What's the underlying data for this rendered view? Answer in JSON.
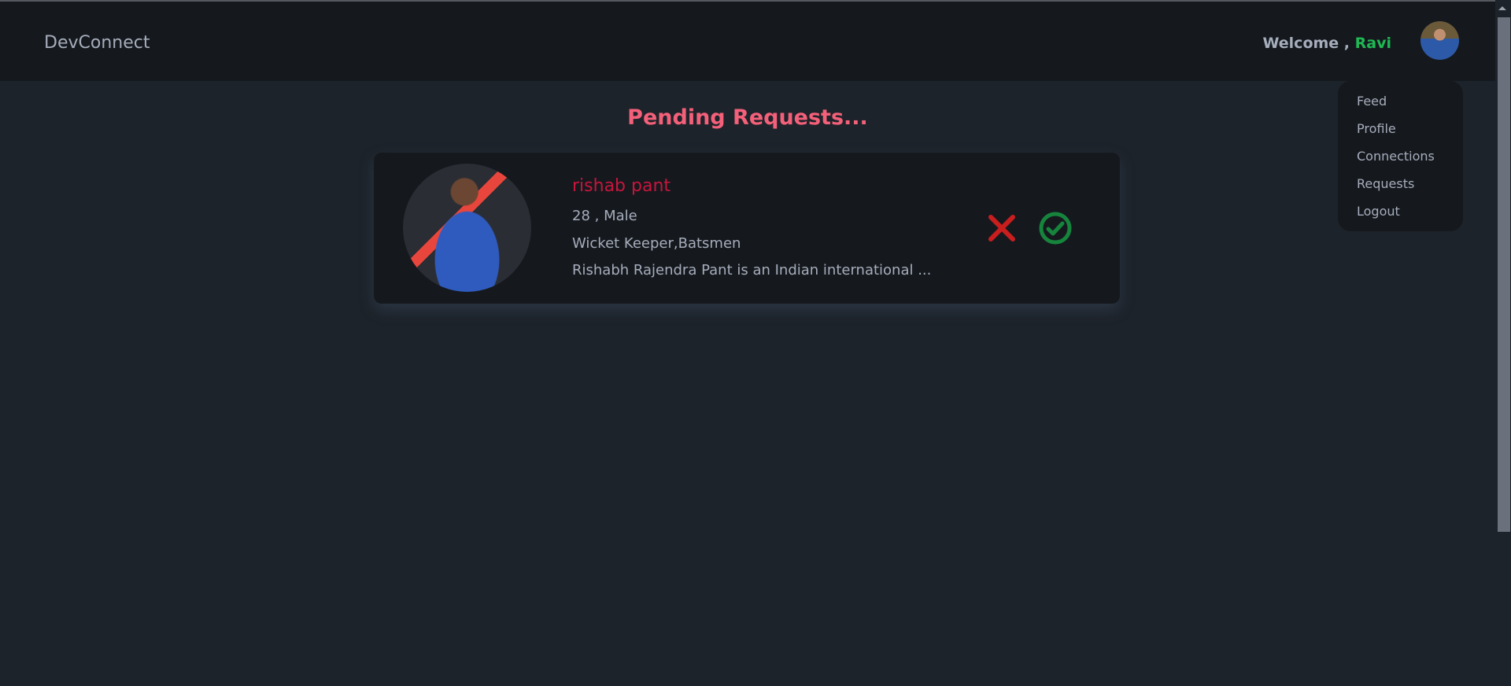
{
  "navbar": {
    "brand": "DevConnect",
    "welcome": "Welcome , ",
    "user_name": "Ravi"
  },
  "menu": [
    "Feed",
    "Profile",
    "Connections",
    "Requests",
    "Logout"
  ],
  "page_title": "Pending Requests...",
  "requests": [
    {
      "name": "rishab pant",
      "age_gender": "28 , Male",
      "skills": "Wicket Keeper,Batsmen",
      "about": "Rishabh Rajendra Pant is an Indian international ..."
    }
  ],
  "colors": {
    "accent": "#f4607a",
    "name": "#c8153c",
    "success": "#16843c",
    "reject": "#c81e1e",
    "user": "#1fb854"
  }
}
